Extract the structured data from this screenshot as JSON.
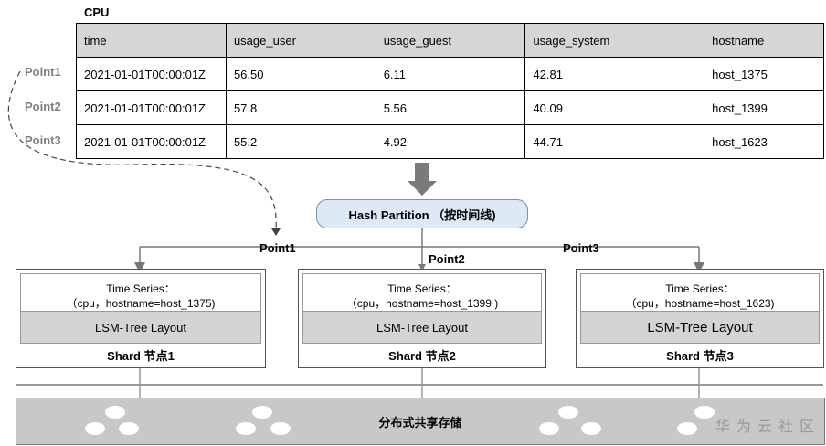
{
  "table": {
    "title": "CPU",
    "headers": [
      "time",
      "usage_user",
      "usage_guest",
      "usage_system",
      "hostname"
    ],
    "rows": [
      [
        "2021-01-01T00:00:01Z",
        "56.50",
        "6.11",
        "42.81",
        "host_1375"
      ],
      [
        "2021-01-01T00:00:01Z",
        "57.8",
        "5.56",
        "40.09",
        "host_1399"
      ],
      [
        "2021-01-01T00:00:01Z",
        "55.2",
        "4.92",
        "44.71",
        "host_1623"
      ]
    ]
  },
  "points": [
    "Point1",
    "Point2",
    "Point3"
  ],
  "hash_partition": "Hash Partition （按时间线)",
  "shards": [
    {
      "ts_title": "Time Series：",
      "ts_key": "（cpu，hostname=host_1375)",
      "layout": "LSM-Tree Layout",
      "name": "Shard 节点1"
    },
    {
      "ts_title": "Time Series：",
      "ts_key": "（cpu，hostname=host_1399 )",
      "layout": "LSM-Tree Layout",
      "name": "Shard 节点2"
    },
    {
      "ts_title": "Time Series：",
      "ts_key": "（cpu，hostname=host_1623)",
      "layout": "LSM-Tree Layout",
      "name": "Shard 节点3"
    }
  ],
  "storage": "分布式共享存储",
  "watermark": "华为云社区",
  "colors": {
    "header_bg": "#d6d6d6",
    "hash_bg": "#dde9f5",
    "layout_bg": "#d4d4d4",
    "storage_bg": "#c8c8c8",
    "arrow": "#777777"
  }
}
